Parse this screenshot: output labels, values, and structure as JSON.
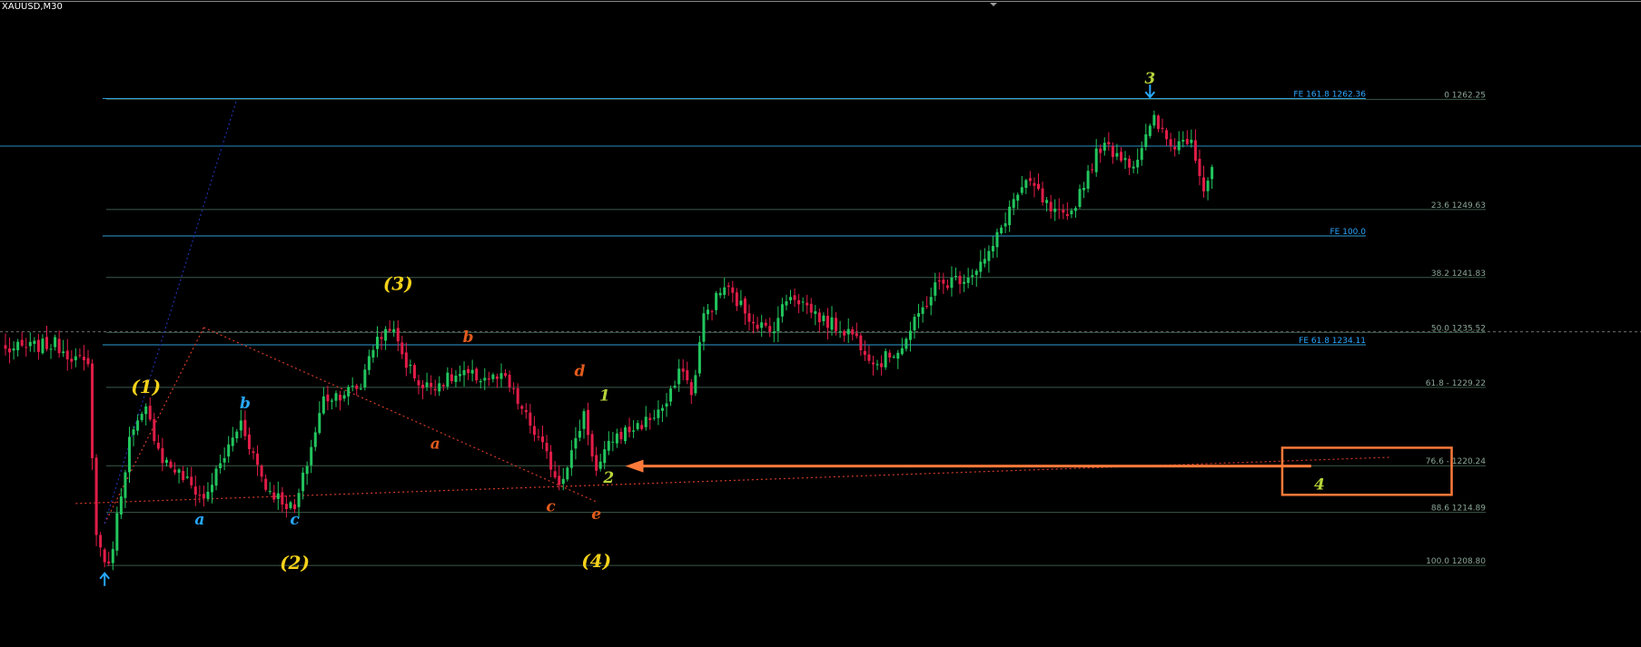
{
  "header": {
    "symbol_label": "XAUUSD,M30"
  },
  "colors": {
    "background": "#000000",
    "bull": "#22c55e",
    "bear": "#e11d48",
    "fib_line": "#3a5a4a",
    "fe_line": "#2e9bd6",
    "fe_label": "#2aa7ff",
    "fib_label": "#8aa597",
    "wave_yellow": "#f4d21a",
    "wave_green": "#b6d43a",
    "wave_blue": "#27a9ff",
    "wave_orange": "#e35b1c",
    "highlight": "#ff7a3a",
    "trend_red": "#d23a2a",
    "trend_blue": "#1f2fa8",
    "grid_ref": "#8a8a8a"
  },
  "chart_data": {
    "type": "candlestick",
    "symbol": "XAUUSD",
    "timeframe": "M30",
    "ylim": [
      1206.0,
      1264.5
    ],
    "reference_lines": [
      {
        "price": 1256.9
      },
      {
        "price": 1235.6
      }
    ],
    "fib_levels": [
      {
        "label": "0 1262.25",
        "price": 1262.25
      },
      {
        "label": "23.6 1249.63",
        "price": 1249.63
      },
      {
        "label": "38.2 1241.83",
        "price": 1241.83
      },
      {
        "label": "50.0 1235.52",
        "price": 1235.52
      },
      {
        "label": "61.8 - 1229.22",
        "price": 1229.22
      },
      {
        "label": "76.6 - 1220.24",
        "price": 1220.24
      },
      {
        "label": "88.6 1214.89",
        "price": 1214.89
      },
      {
        "label": "100.0 1208.80",
        "price": 1208.8
      }
    ],
    "fe_levels": [
      {
        "label": "FE 161.8 1262.36",
        "price": 1262.36
      },
      {
        "label": "FE 100.0",
        "price": 1246.6
      },
      {
        "label": "FE 61.8 1234.11",
        "price": 1234.11
      }
    ],
    "wave_labels": [
      {
        "text": "(1)",
        "style": "yellow",
        "bar": 34,
        "price": 1228.6
      },
      {
        "text": "(2)",
        "style": "yellow",
        "bar": 70,
        "price": 1208.4
      },
      {
        "text": "(3)",
        "style": "yellow",
        "bar": 95,
        "price": 1240.4
      },
      {
        "text": "(4)",
        "style": "yellow",
        "bar": 143,
        "price": 1208.6
      },
      {
        "text": "a",
        "style": "blue",
        "bar": 47,
        "price": 1213.5
      },
      {
        "text": "b",
        "style": "blue",
        "bar": 58,
        "price": 1226.8
      },
      {
        "text": "c",
        "style": "blue",
        "bar": 70,
        "price": 1213.5
      },
      {
        "text": "a",
        "style": "orange",
        "bar": 104,
        "price": 1222.2
      },
      {
        "text": "b",
        "style": "orange",
        "bar": 112,
        "price": 1234.4
      },
      {
        "text": "c",
        "style": "orange",
        "bar": 132,
        "price": 1215.0
      },
      {
        "text": "d",
        "style": "orange",
        "bar": 139,
        "price": 1230.5
      },
      {
        "text": "e",
        "style": "orange",
        "bar": 143,
        "price": 1214.1
      },
      {
        "text": "1",
        "style": "green",
        "bar": 145,
        "price": 1227.7
      },
      {
        "text": "2",
        "style": "green",
        "bar": 146,
        "price": 1218.3
      },
      {
        "text": "3",
        "style": "green",
        "bar": 277,
        "price": 1264.1
      },
      {
        "text": "4",
        "style": "green",
        "bar": 318,
        "price": 1217.5
      }
    ],
    "markers": [
      {
        "type": "arrow-up",
        "bar": 24,
        "price": 1207.9
      },
      {
        "type": "arrow-down",
        "bar": 277,
        "price": 1262.5
      }
    ],
    "annotations": [
      {
        "type": "highlight-box",
        "from_bar": 309,
        "to_bar": 350,
        "price_top": 1222.3,
        "price_bottom": 1216.9
      },
      {
        "type": "arrow",
        "from_bar": 316,
        "to_bar": 150,
        "price": 1220.2
      }
    ],
    "trendlines": [
      {
        "style": "red-dotted",
        "from": [
          17,
          1215.9
        ],
        "to": [
          335,
          1221.2
        ]
      },
      {
        "style": "red-dotted",
        "from": [
          48,
          1236.1
        ],
        "to": [
          143,
          1216.1
        ]
      },
      {
        "style": "red-dotted",
        "from": [
          24,
          1213.6
        ],
        "to": [
          48,
          1236.1
        ]
      },
      {
        "style": "blue-dotted",
        "from": [
          24,
          1213.6
        ],
        "to": [
          56,
          1262.3
        ]
      }
    ],
    "pivots": [
      [
        0,
        1233.5
      ],
      [
        12,
        1234.2
      ],
      [
        20,
        1231.5
      ],
      [
        22,
        1212.1
      ],
      [
        25,
        1208.4
      ],
      [
        30,
        1223.2
      ],
      [
        34,
        1226.5
      ],
      [
        38,
        1221.1
      ],
      [
        43,
        1218.9
      ],
      [
        48,
        1216.4
      ],
      [
        57,
        1225.3
      ],
      [
        63,
        1217.8
      ],
      [
        70,
        1215.1
      ],
      [
        77,
        1227.9
      ],
      [
        86,
        1229.3
      ],
      [
        88,
        1233.2
      ],
      [
        93,
        1236.4
      ],
      [
        97,
        1232.0
      ],
      [
        101,
        1229.2
      ],
      [
        110,
        1230.6
      ],
      [
        121,
        1230.1
      ],
      [
        130,
        1222.3
      ],
      [
        134,
        1218.3
      ],
      [
        138,
        1222.9
      ],
      [
        140,
        1226.4
      ],
      [
        143,
        1219.5
      ],
      [
        147,
        1223.4
      ],
      [
        155,
        1225.3
      ],
      [
        160,
        1227.3
      ],
      [
        164,
        1231.7
      ],
      [
        166,
        1228.1
      ],
      [
        169,
        1237.3
      ],
      [
        174,
        1240.8
      ],
      [
        180,
        1237.4
      ],
      [
        185,
        1235.5
      ],
      [
        190,
        1240.1
      ],
      [
        198,
        1236.9
      ],
      [
        205,
        1235.4
      ],
      [
        211,
        1231.9
      ],
      [
        217,
        1234.0
      ],
      [
        225,
        1240.8
      ],
      [
        233,
        1242.1
      ],
      [
        238,
        1244.3
      ],
      [
        244,
        1250.8
      ],
      [
        248,
        1252.7
      ],
      [
        253,
        1249.4
      ],
      [
        257,
        1248.3
      ],
      [
        262,
        1253.9
      ],
      [
        265,
        1256.9
      ],
      [
        269,
        1256.2
      ],
      [
        273,
        1254.8
      ],
      [
        278,
        1259.8
      ],
      [
        282,
        1256.9
      ],
      [
        287,
        1258.0
      ],
      [
        290,
        1252.0
      ],
      [
        292,
        1254.5
      ]
    ]
  }
}
